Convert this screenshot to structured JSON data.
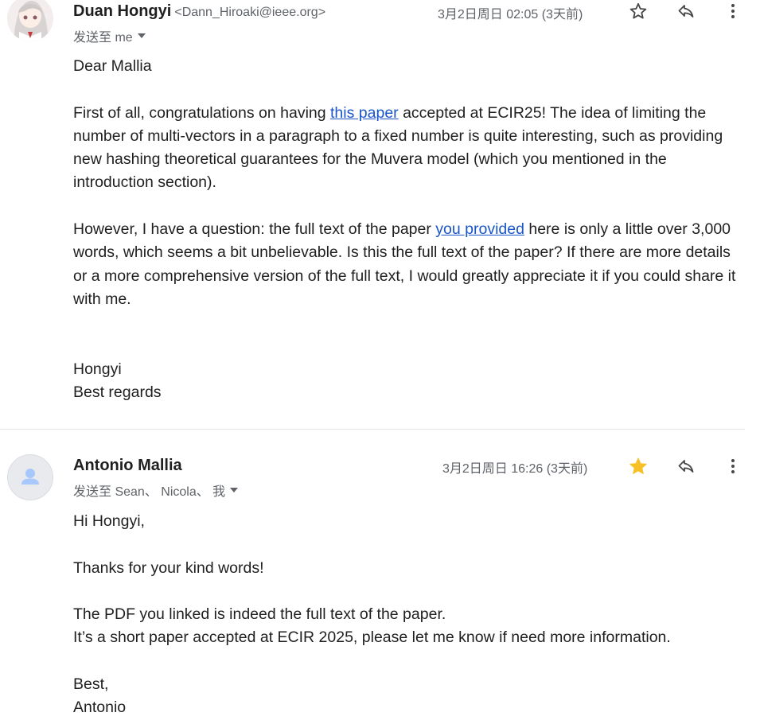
{
  "message1": {
    "sender_name": "Duan Hongyi",
    "sender_email": "<Dann_Hiroaki@ieee.org>",
    "date": "3月2日周日 02:05 (3天前)",
    "to_line": "发送至 me",
    "greeting": "Dear Mallia",
    "p1_before": "First of all, congratulations on having ",
    "p1_link": "this paper",
    "p1_after_line1": " accepted at ECIR25! The idea of limiting the",
    "p1_line2": "number of multi-vectors in a paragraph to a fixed number is quite interesting, such as providing",
    "p1_line3": "new hashing theoretical guarantees for the Muvera model (which you mentioned in the",
    "p1_line4": "introduction section).",
    "p2_before": "However, I have a question: the full text of the paper ",
    "p2_link": "you provided",
    "p2_after_line1": " here is only a little over 3,000",
    "p2_line2": "words, which seems a bit unbelievable. Is this the full text of the paper? If there are more details",
    "p2_line3": "or a more comprehensive version of the full text, I would greatly appreciate it if you could share it",
    "p2_line4": "with me.",
    "sign_name": "Hongyi",
    "sign_off": "Best regards",
    "starred": false
  },
  "message2": {
    "sender_name": "Antonio Mallia",
    "date": "3月2日周日 16:26 (3天前)",
    "to_line": "发送至 Sean、 Nicola、 我",
    "greeting": "Hi Hongyi,",
    "line_thanks": "Thanks for your kind words!",
    "line_pdf": "The PDF you linked is indeed the full text of the paper.",
    "line_short": "It’s a short paper accepted at ECIR 2025, please let me know if need more information.",
    "sign_off": "Best,",
    "sign_name": "Antonio",
    "starred": true
  },
  "colors": {
    "star_filled": "#f6c026",
    "link": "#1a56c9",
    "muted_text": "#5f6368"
  },
  "icons": {
    "star": "star-icon",
    "reply": "reply-icon",
    "more": "more-vert-icon",
    "avatar_generic": "person-icon"
  }
}
